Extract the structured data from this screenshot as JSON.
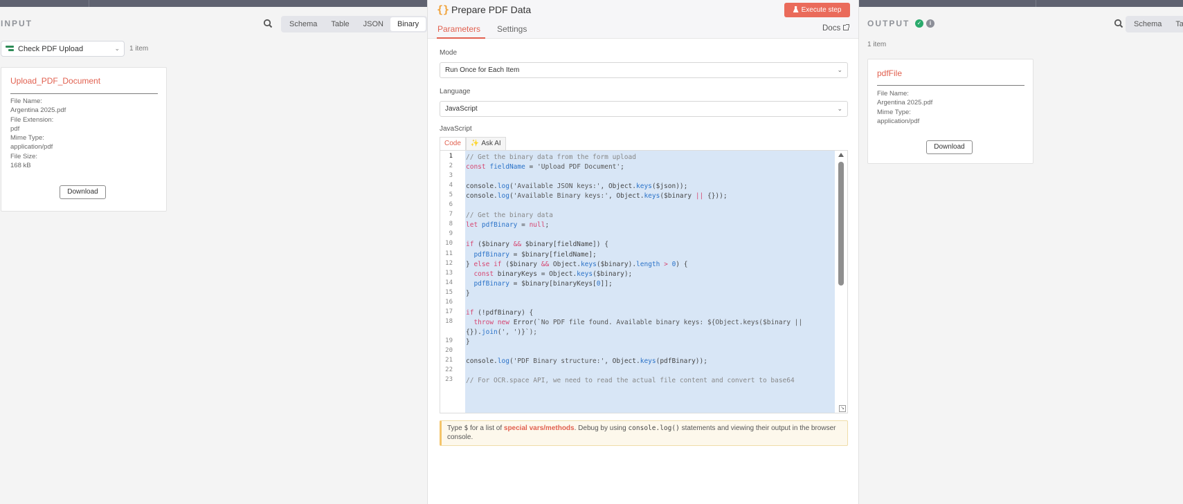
{
  "input": {
    "title": "INPUT",
    "tabs": [
      "Schema",
      "Table",
      "JSON",
      "Binary"
    ],
    "node_select": "Check PDF Upload",
    "items_count": "1 item",
    "card": {
      "title": "Upload_PDF_Document",
      "file_name_label": "File Name:",
      "file_name": "Argentina 2025.pdf",
      "file_ext_label": "File Extension:",
      "file_ext": "pdf",
      "mime_label": "Mime Type:",
      "mime": "application/pdf",
      "size_label": "File Size:",
      "size": "168 kB",
      "download": "Download"
    }
  },
  "center": {
    "title": "Prepare PDF Data",
    "execute": "Execute step",
    "tabs": [
      "Parameters",
      "Settings"
    ],
    "docs": "Docs",
    "mode_label": "Mode",
    "mode_value": "Run Once for Each Item",
    "language_label": "Language",
    "language_value": "JavaScript",
    "js_label": "JavaScript",
    "code_tabs": [
      "Code",
      "Ask AI"
    ],
    "hint": {
      "pre": "Type ",
      "dollar": "$",
      "mid1": " for a list of ",
      "link": "special vars/methods",
      "mid2": ". Debug by using ",
      "code": "console.log()",
      "post": " statements and viewing their output in the browser console."
    },
    "code_lines": [
      {
        "n": "1",
        "t": "// Get the binary data from the form upload"
      },
      {
        "n": "2",
        "t": "const fieldName = 'Upload PDF Document';"
      },
      {
        "n": "3",
        "t": ""
      },
      {
        "n": "4",
        "t": "console.log('Available JSON keys:', Object.keys($json));"
      },
      {
        "n": "5",
        "t": "console.log('Available Binary keys:', Object.keys($binary || {}));"
      },
      {
        "n": "6",
        "t": ""
      },
      {
        "n": "7",
        "t": "// Get the binary data"
      },
      {
        "n": "8",
        "t": "let pdfBinary = null;"
      },
      {
        "n": "9",
        "t": ""
      },
      {
        "n": "10",
        "t": "if ($binary && $binary[fieldName]) {"
      },
      {
        "n": "11",
        "t": "  pdfBinary = $binary[fieldName];"
      },
      {
        "n": "12",
        "t": "} else if ($binary && Object.keys($binary).length > 0) {"
      },
      {
        "n": "13",
        "t": "  const binaryKeys = Object.keys($binary);"
      },
      {
        "n": "14",
        "t": "  pdfBinary = $binary[binaryKeys[0]];"
      },
      {
        "n": "15",
        "t": "}"
      },
      {
        "n": "16",
        "t": ""
      },
      {
        "n": "17",
        "t": "if (!pdfBinary) {"
      },
      {
        "n": "18",
        "t": "  throw new Error(`No PDF file found. Available binary keys: ${Object.keys($binary ||"
      },
      {
        "n": "",
        "t": "{}).join(', ')}`);"
      },
      {
        "n": "19",
        "t": "}"
      },
      {
        "n": "20",
        "t": ""
      },
      {
        "n": "21",
        "t": "console.log('PDF Binary structure:', Object.keys(pdfBinary));"
      },
      {
        "n": "22",
        "t": ""
      },
      {
        "n": "23",
        "t": "// For OCR.space API, we need to read the actual file content and convert to base64"
      }
    ]
  },
  "output": {
    "title": "OUTPUT",
    "tabs": [
      "Schema",
      "Ta"
    ],
    "items_count": "1 item",
    "card": {
      "title": "pdfFile",
      "file_name_label": "File Name:",
      "file_name": "Argentina 2025.pdf",
      "mime_label": "Mime Type:",
      "mime": "application/pdf",
      "download": "Download"
    }
  },
  "icons": {
    "search": "search-icon",
    "braces": "code-braces-icon",
    "flask": "flask-icon",
    "sparkle": "sparkle-icon",
    "external": "external-link-icon",
    "success": "check-circle-icon",
    "info": "info-icon"
  },
  "colors": {
    "accent": "#ea6b5b",
    "success": "#2aaa6c",
    "selection": "#d8e6f6"
  }
}
